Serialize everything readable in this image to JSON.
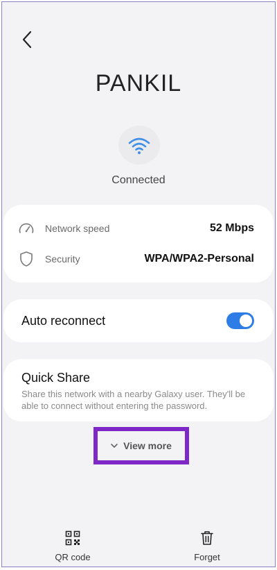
{
  "header": {
    "back_icon": "chevron-left-icon"
  },
  "network": {
    "name": "PANKIL",
    "status": "Connected",
    "wifi_icon": "wifi-icon",
    "accent_color": "#2e7ce6"
  },
  "info": [
    {
      "icon": "speedometer-icon",
      "label": "Network speed",
      "value": "52 Mbps"
    },
    {
      "icon": "shield-icon",
      "label": "Security",
      "value": "WPA/WPA2-Personal"
    }
  ],
  "auto_reconnect": {
    "label": "Auto reconnect",
    "enabled": true
  },
  "quick_share": {
    "title": "Quick Share",
    "description": "Share this network with a nearby Galaxy user. They'll be able to connect without entering the password."
  },
  "view_more": {
    "label": "View more",
    "icon": "chevron-down-icon"
  },
  "bottom_bar": [
    {
      "icon": "qr-code-icon",
      "label": "QR code"
    },
    {
      "icon": "trash-icon",
      "label": "Forget"
    }
  ]
}
